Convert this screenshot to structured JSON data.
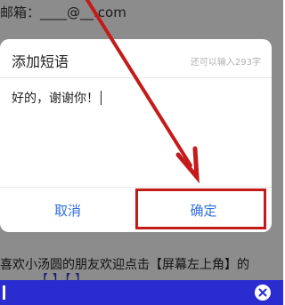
{
  "background": {
    "email_line": "邮箱：____@__.com",
    "promo_line": "喜欢小汤圆的朋友欢迎点击【屏幕左上角】的",
    "promo_line_2": "【                     】【                   】"
  },
  "dialog": {
    "title": "添加短语",
    "counter": "还可以输入293字",
    "input_value": "好的，谢谢你！",
    "cancel_label": "取消",
    "confirm_label": "确定"
  },
  "colors": {
    "overlay": "#000000",
    "button_text": "#2f6fe0",
    "annotation": "#c41a1a",
    "bottom_bar": "#2a2ccf"
  },
  "icons": {
    "bottom_bar_close": "close-circle-icon"
  }
}
